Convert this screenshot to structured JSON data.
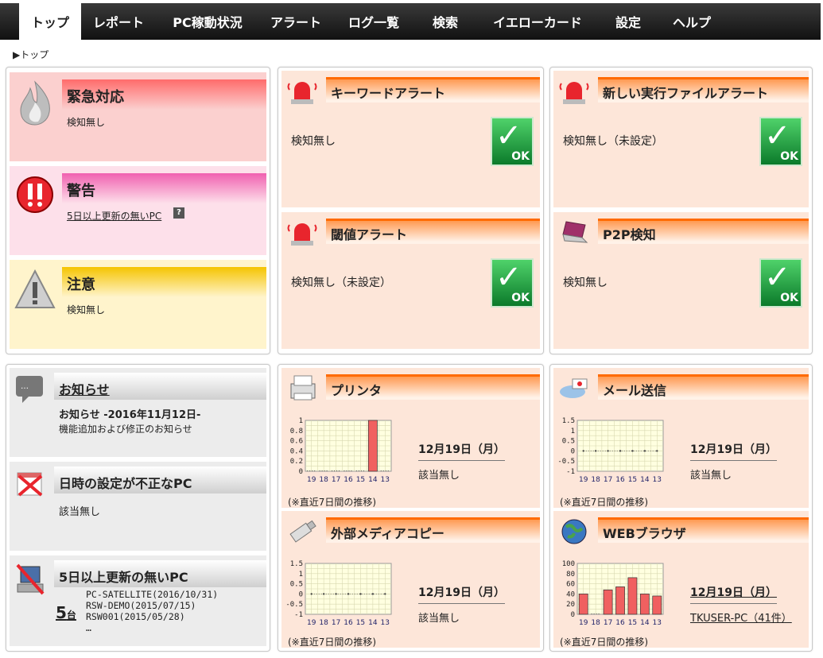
{
  "nav": {
    "tabs": [
      "トップ",
      "レポート",
      "PC稼動状況",
      "アラート",
      "ログ一覧",
      "検索",
      "イエローカード",
      "設定",
      "ヘルプ"
    ],
    "active": 0
  },
  "breadcrumb": "▶トップ",
  "status": {
    "emergency": {
      "title": "緊急対応",
      "text": "検知無し"
    },
    "warning": {
      "title": "警告",
      "link": "5日以上更新の無いPC"
    },
    "caution": {
      "title": "注意",
      "text": "検知無し"
    }
  },
  "alerts": {
    "keyword": {
      "title": "キーワードアラート",
      "text": "検知無し",
      "badge": "OK"
    },
    "newexe": {
      "title": "新しい実行ファイルアラート",
      "text": "検知無し（未設定）",
      "badge": "OK"
    },
    "threshold": {
      "title": "閾値アラート",
      "text": "検知無し（未設定）",
      "badge": "OK"
    },
    "p2p": {
      "title": "P2P検知",
      "text": "検知無し",
      "badge": "OK"
    }
  },
  "info": {
    "news": {
      "title": "お知らせ",
      "headline": "お知らせ -2016年11月12日-",
      "body": "機能追加および修正のお知らせ"
    },
    "datetime": {
      "title": "日時の設定が不正なPC",
      "text": "該当無し"
    },
    "stale": {
      "title": "5日以上更新の無いPC",
      "count": "5",
      "unit": "台",
      "pcs": [
        "PC-SATELLITE(2016/10/31)",
        "RSW-DEMO(2015/07/15)",
        "RSW001(2015/05/28)"
      ],
      "more": "…"
    }
  },
  "graphs": {
    "printer": {
      "title": "プリンタ",
      "date": "12月19日（月）",
      "result": "該当無し",
      "note": "(※直近7日間の推移)"
    },
    "mail": {
      "title": "メール送信",
      "date": "12月19日（月）",
      "result": "該当無し",
      "note": "(※直近7日間の推移)"
    },
    "media": {
      "title": "外部メディアコピー",
      "date": "12月19日（月）",
      "result": "該当無し",
      "note": "(※直近7日間の推移)"
    },
    "web": {
      "title": "WEBブラウザ",
      "date": "12月19日（月）",
      "result": "TKUSER-PC（41件）",
      "note": "(※直近7日間の推移)"
    }
  },
  "chart_data": [
    {
      "type": "bar",
      "name": "printer",
      "categories": [
        "19",
        "18",
        "17",
        "16",
        "15",
        "14",
        "13"
      ],
      "values": [
        0,
        0,
        0,
        0,
        0,
        1,
        0
      ],
      "ylim": [
        0,
        1
      ],
      "yticks": [
        "1",
        "0.8",
        "0.6",
        "0.4",
        "0.2",
        "0"
      ],
      "color": "#f06060"
    },
    {
      "type": "line",
      "name": "mail",
      "categories": [
        "19",
        "18",
        "17",
        "16",
        "15",
        "14",
        "13"
      ],
      "values": [
        0,
        0,
        0,
        0,
        0,
        0,
        0
      ],
      "ylim": [
        -1,
        1.5
      ],
      "yticks": [
        "1.5",
        "1",
        "0.5",
        "0",
        "-0.5",
        "-1"
      ]
    },
    {
      "type": "line",
      "name": "media",
      "categories": [
        "19",
        "18",
        "17",
        "16",
        "15",
        "14",
        "13"
      ],
      "values": [
        0,
        0,
        0,
        0,
        0,
        0,
        0
      ],
      "ylim": [
        -1,
        1.5
      ],
      "yticks": [
        "1.5",
        "1",
        "0.5",
        "0",
        "-0.5",
        "-1"
      ]
    },
    {
      "type": "bar",
      "name": "web",
      "categories": [
        "19",
        "18",
        "17",
        "16",
        "15",
        "14",
        "13"
      ],
      "values": [
        40,
        0,
        48,
        54,
        72,
        40,
        36
      ],
      "ylim": [
        0,
        100
      ],
      "yticks": [
        "100",
        "80",
        "60",
        "40",
        "20",
        "0"
      ],
      "color": "#f06060"
    }
  ]
}
